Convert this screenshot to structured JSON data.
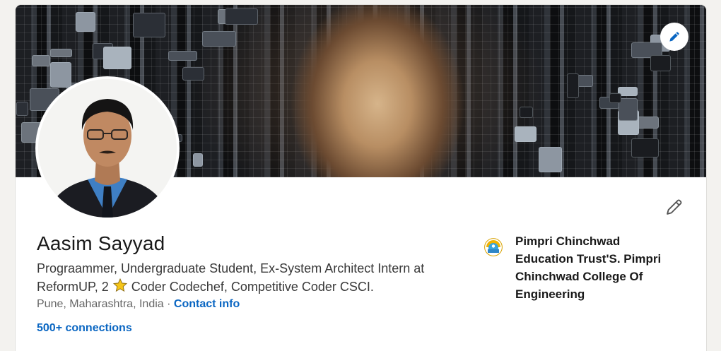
{
  "profile": {
    "name": "Aasim Sayyad",
    "headline_part1": "Prograammer, Undergraduate Student, Ex-System Architect Intern at ReformUP, 2",
    "headline_part2": "Coder Codechef, Competitive Coder CSCI.",
    "location": "Pune, Maharashtra, India",
    "separator": "·",
    "contact_info_label": "Contact info",
    "connections_label": "500+ connections"
  },
  "education": {
    "school_name": "Pimpri Chinchwad Education Trust'S. Pimpri Chinchwad College Of Engineering"
  },
  "icons": {
    "banner_edit": "pencil-icon",
    "intro_edit": "pencil-icon",
    "headline_star": "star-icon",
    "school_logo": "school-logo-icon"
  },
  "colors": {
    "link": "#0a66c2",
    "page_background": "#f3f2ef",
    "star": "#f5c518"
  }
}
